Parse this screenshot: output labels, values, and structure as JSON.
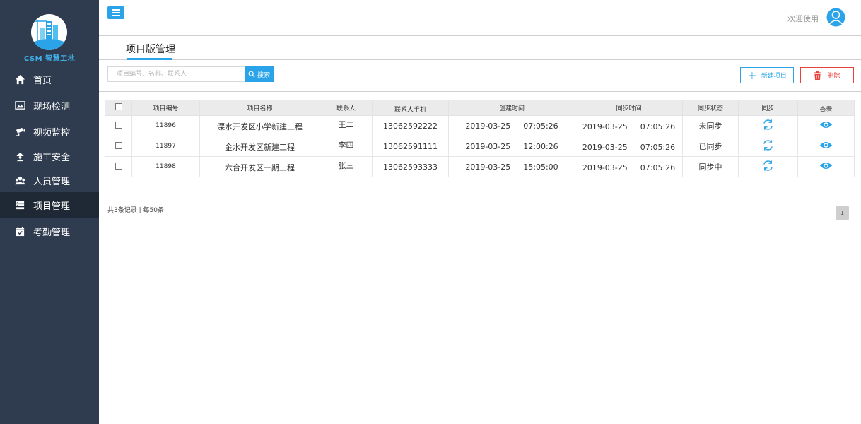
{
  "brand": {
    "logo_text": "CSM 智慧工地"
  },
  "sidebar": {
    "items": [
      {
        "label": "首页",
        "icon": "home-icon"
      },
      {
        "label": "现场检测",
        "icon": "monitor-image-icon"
      },
      {
        "label": "视频监控",
        "icon": "camera-icon"
      },
      {
        "label": "施工安全",
        "icon": "worker-icon"
      },
      {
        "label": "人员管理",
        "icon": "people-icon"
      },
      {
        "label": "项目管理",
        "icon": "list-icon",
        "active": true
      },
      {
        "label": "考勤管理",
        "icon": "calendar-check-icon"
      }
    ]
  },
  "header": {
    "welcome": "欢迎使用",
    "menu_icon": "hamburger-icon",
    "avatar_icon": "user-avatar-icon"
  },
  "page": {
    "title": "项目版管理"
  },
  "toolbar": {
    "search_placeholder": "项目编号、名称、联系人",
    "search_label": "搜索",
    "new_label": "新建项目",
    "delete_label": "删除"
  },
  "table": {
    "headers": [
      "项目编号",
      "项目名称",
      "联系人",
      "联系人手机",
      "创建时间",
      "同步时间",
      "同步状态",
      "同步",
      "查看"
    ],
    "rows": [
      {
        "id": "11896",
        "name": "溧水开发区小学新建工程",
        "contact": "王二",
        "phone": "13062592222",
        "created_date": "2019-03-25",
        "created_time": "07:05:26",
        "sync_date": "2019-03-25",
        "sync_time": "07:05:26",
        "status": "未同步"
      },
      {
        "id": "11897",
        "name": "金水开发区新建工程",
        "contact": "李四",
        "phone": "13062591111",
        "created_date": "2019-03-25",
        "created_time": "12:00:26",
        "sync_date": "2019-03-25",
        "sync_time": "07:05:26",
        "status": "已同步"
      },
      {
        "id": "11898",
        "name": "六合开发区一期工程",
        "contact": "张三",
        "phone": "13062593333",
        "created_date": "2019-03-25",
        "created_time": "15:05:00",
        "sync_date": "2019-03-25",
        "sync_time": "07:05:26",
        "status": "同步中"
      }
    ]
  },
  "footer": {
    "summary": "共3条记录 | 每50条",
    "page": "1"
  },
  "colors": {
    "sidebar_bg": "#2f3c4f",
    "sidebar_active": "#1f2936",
    "accent": "#2aa3e8",
    "danger": "#e8413a"
  }
}
